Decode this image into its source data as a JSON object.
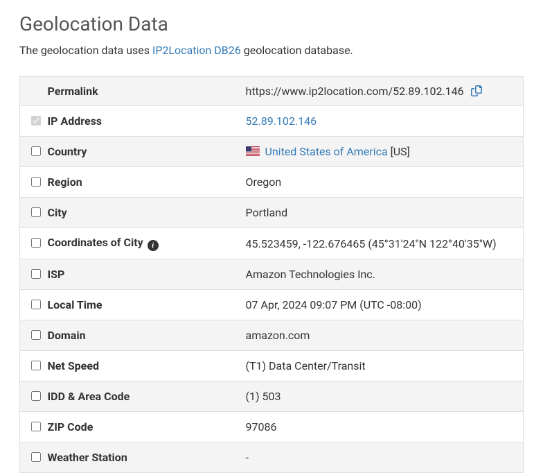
{
  "title": "Geolocation Data",
  "description_prefix": "The geolocation data uses ",
  "description_link_text": "IP2Location DB26",
  "description_suffix": " geolocation database.",
  "rows": {
    "permalink": {
      "label": "Permalink",
      "value": "https://www.ip2location.com/52.89.102.146"
    },
    "ip_address": {
      "label": "IP Address",
      "value": "52.89.102.146"
    },
    "country": {
      "label": "Country",
      "link_text": "United States of America",
      "suffix": " [US]"
    },
    "region": {
      "label": "Region",
      "value": "Oregon"
    },
    "city": {
      "label": "City",
      "value": "Portland"
    },
    "coordinates": {
      "label": "Coordinates of City",
      "value": "45.523459, -122.676465 (45°31'24\"N   122°40'35\"W)"
    },
    "isp": {
      "label": "ISP",
      "value": "Amazon Technologies Inc."
    },
    "local_time": {
      "label": "Local Time",
      "value": "07 Apr, 2024 09:07 PM (UTC -08:00)"
    },
    "domain": {
      "label": "Domain",
      "value": "amazon.com"
    },
    "net_speed": {
      "label": "Net Speed",
      "value": "(T1) Data Center/Transit"
    },
    "idd_area": {
      "label": "IDD & Area Code",
      "value": "(1) 503"
    },
    "zip": {
      "label": "ZIP Code",
      "value": "97086"
    },
    "weather": {
      "label": "Weather Station",
      "value": "-"
    }
  }
}
